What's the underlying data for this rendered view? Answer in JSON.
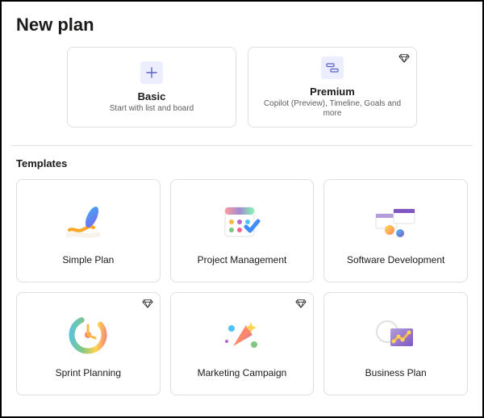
{
  "title": "New plan",
  "plan_options": [
    {
      "id": "basic",
      "title": "Basic",
      "subtitle": "Start with list and board",
      "premium": false,
      "icon": "plus-icon"
    },
    {
      "id": "premium",
      "title": "Premium",
      "subtitle": "Copilot (Preview), Timeline, Goals and more",
      "premium": true,
      "icon": "timeline-icon"
    }
  ],
  "templates_section_title": "Templates",
  "templates": [
    {
      "id": "simple-plan",
      "label": "Simple Plan",
      "premium": false
    },
    {
      "id": "project-management",
      "label": "Project Management",
      "premium": false
    },
    {
      "id": "software-development",
      "label": "Software Development",
      "premium": false
    },
    {
      "id": "sprint-planning",
      "label": "Sprint Planning",
      "premium": true
    },
    {
      "id": "marketing-campaign",
      "label": "Marketing Campaign",
      "premium": true
    },
    {
      "id": "business-plan",
      "label": "Business Plan",
      "premium": false
    }
  ],
  "colors": {
    "border": "#e1dfdd",
    "icon_bg": "#eceefe",
    "accent": "#5b5fc7"
  }
}
